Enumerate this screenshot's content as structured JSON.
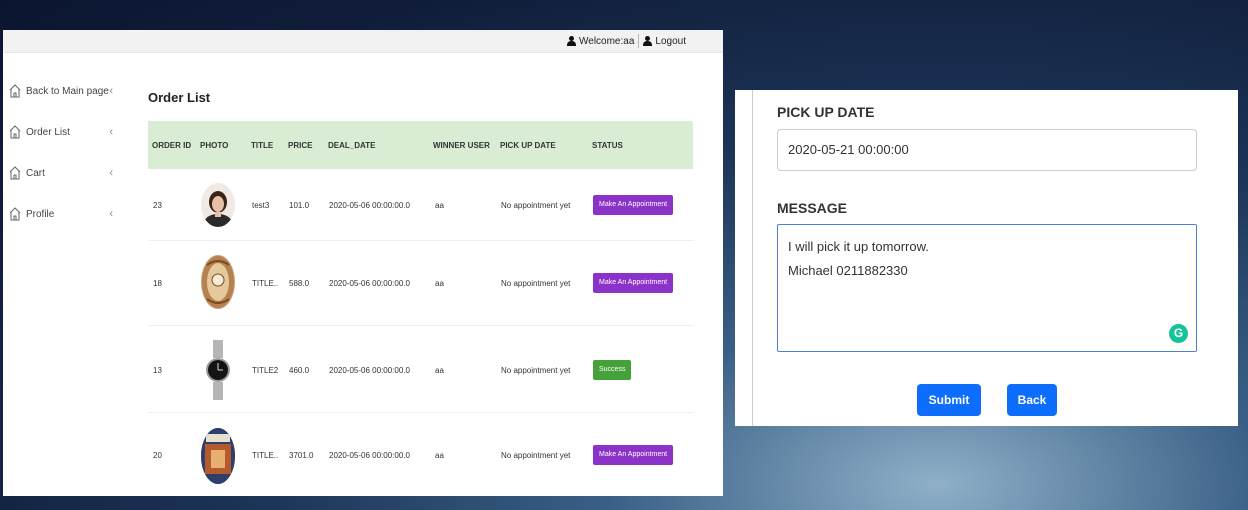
{
  "topbar": {
    "welcome": "Welcome:aa",
    "logout": "Logout"
  },
  "sidebar": {
    "items": [
      {
        "label": "Back to Main page"
      },
      {
        "label": "Order List"
      },
      {
        "label": "Cart"
      },
      {
        "label": "Profile"
      }
    ]
  },
  "main": {
    "title": "Order List",
    "columns": [
      "ORDER ID",
      "PHOTO",
      "TITLE",
      "PRICE",
      "DEAL_DATE",
      "WINNER USER",
      "PICK UP DATE",
      "STATUS"
    ],
    "rows": [
      {
        "order_id": "23",
        "title": "test3",
        "price": "101.0",
        "deal_date": "2020-05-06 00:00:00.0",
        "winner": "aa",
        "pickup": "No appointment yet",
        "status": "Make An Appointment",
        "photo": "woman-portrait"
      },
      {
        "order_id": "18",
        "title": "TITLE..",
        "price": "588.0",
        "deal_date": "2020-05-06 00:00:00.0",
        "winner": "aa",
        "pickup": "No appointment yet",
        "status": "Make An Appointment",
        "photo": "ornate-clock"
      },
      {
        "order_id": "13",
        "title": "TITLE2",
        "price": "460.0",
        "deal_date": "2020-05-06 00:00:00.0",
        "winner": "aa",
        "pickup": "No appointment yet",
        "status": "Success",
        "photo": "wristwatch"
      },
      {
        "order_id": "20",
        "title": "TITLE..",
        "price": "3701.0",
        "deal_date": "2020-05-06 00:00:00.0",
        "winner": "aa",
        "pickup": "No appointment yet",
        "status": "Make An Appointment",
        "photo": "book-cover"
      }
    ]
  },
  "form": {
    "pickup_label": "PICK UP DATE",
    "pickup_value": "2020-05-21 00:00:00",
    "message_label": "MESSAGE",
    "message_value": "I will pick it up tomorrow.\nMichael 0211882330",
    "submit": "Submit",
    "back": "Back"
  },
  "colors": {
    "appointment": "#8b33c8",
    "success": "#45a13a",
    "table_header": "#d9edd4",
    "primary": "#0d6efd"
  }
}
